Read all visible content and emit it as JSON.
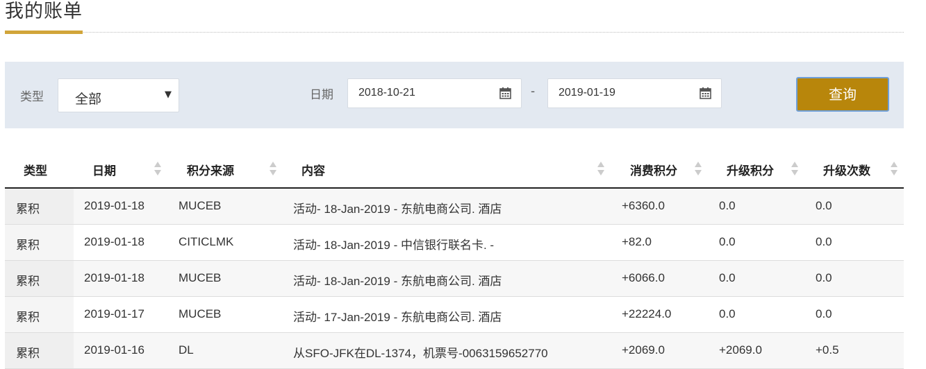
{
  "page": {
    "title": "我的账单"
  },
  "filters": {
    "type_label": "类型",
    "type_value": "全部",
    "date_label": "日期",
    "date_from": "2018-10-21",
    "date_to": "2019-01-19",
    "date_separator": "-",
    "query_label": "查询"
  },
  "table": {
    "headers": [
      "类型",
      "日期",
      "积分来源",
      "内容",
      "消费积分",
      "升级积分",
      "升级次数"
    ],
    "rows": [
      [
        "累积",
        "2019-01-18",
        "MUCEB",
        "活动- 18-Jan-2019 - 东航电商公司. 酒店",
        "+6360.0",
        "0.0",
        "0.0"
      ],
      [
        "累积",
        "2019-01-18",
        "CITICLMK",
        "活动- 18-Jan-2019 - 中信银行联名卡. -",
        "+82.0",
        "0.0",
        "0.0"
      ],
      [
        "累积",
        "2019-01-18",
        "MUCEB",
        "活动- 18-Jan-2019 - 东航电商公司. 酒店",
        "+6066.0",
        "0.0",
        "0.0"
      ],
      [
        "累积",
        "2019-01-17",
        "MUCEB",
        "活动- 17-Jan-2019 - 东航电商公司. 酒店",
        "+22224.0",
        "0.0",
        "0.0"
      ],
      [
        "累积",
        "2019-01-16",
        "DL",
        "从SFO-JFK在DL-1374，机票号-0063159652770",
        "+2069.0",
        "+2069.0",
        "+0.5"
      ]
    ]
  },
  "colors": {
    "accent": "#d1a53a",
    "button": "#b8860b",
    "filter_bg": "#e3e9f1"
  }
}
